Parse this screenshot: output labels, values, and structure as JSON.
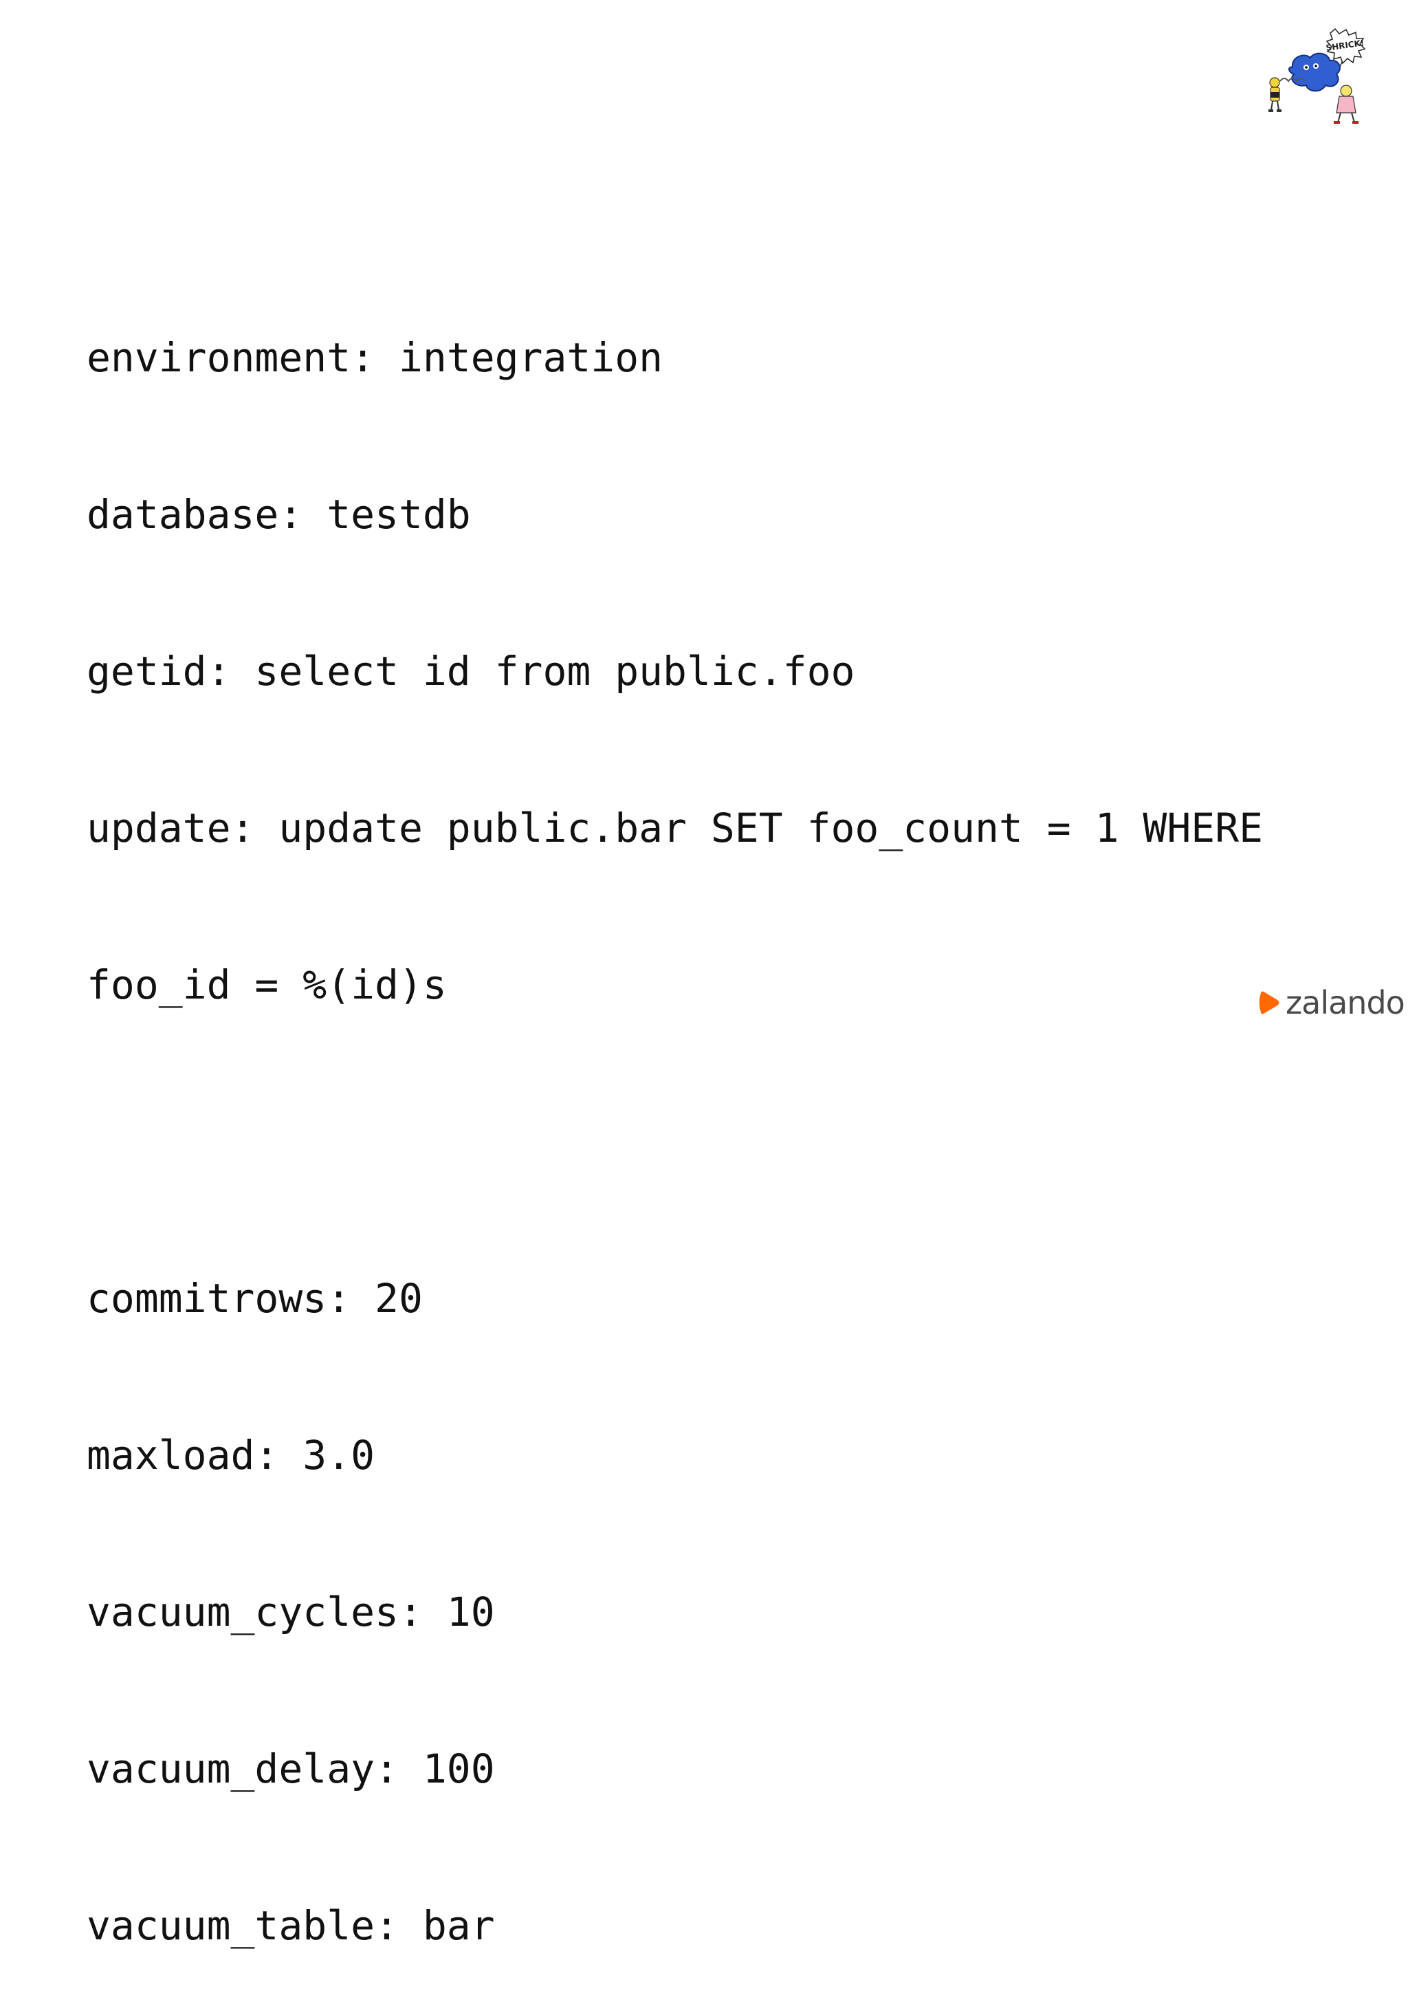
{
  "config_lines": [
    "environment: integration",
    "database: testdb",
    "getid: select id from public.foo",
    "update: update public.bar SET foo_count = 1 WHERE",
    "foo_id = %(id)s",
    "",
    "commitrows: 20",
    "maxload: 3.0",
    "vacuum_cycles: 10",
    "vacuum_delay: 100",
    "vacuum_table: bar"
  ],
  "illustration": {
    "caption": "SHRICK!",
    "icon": "comic-illustration-icon"
  },
  "brand": {
    "name": "zalando",
    "icon": "zalando-logo-icon",
    "color": "#ff6900"
  }
}
